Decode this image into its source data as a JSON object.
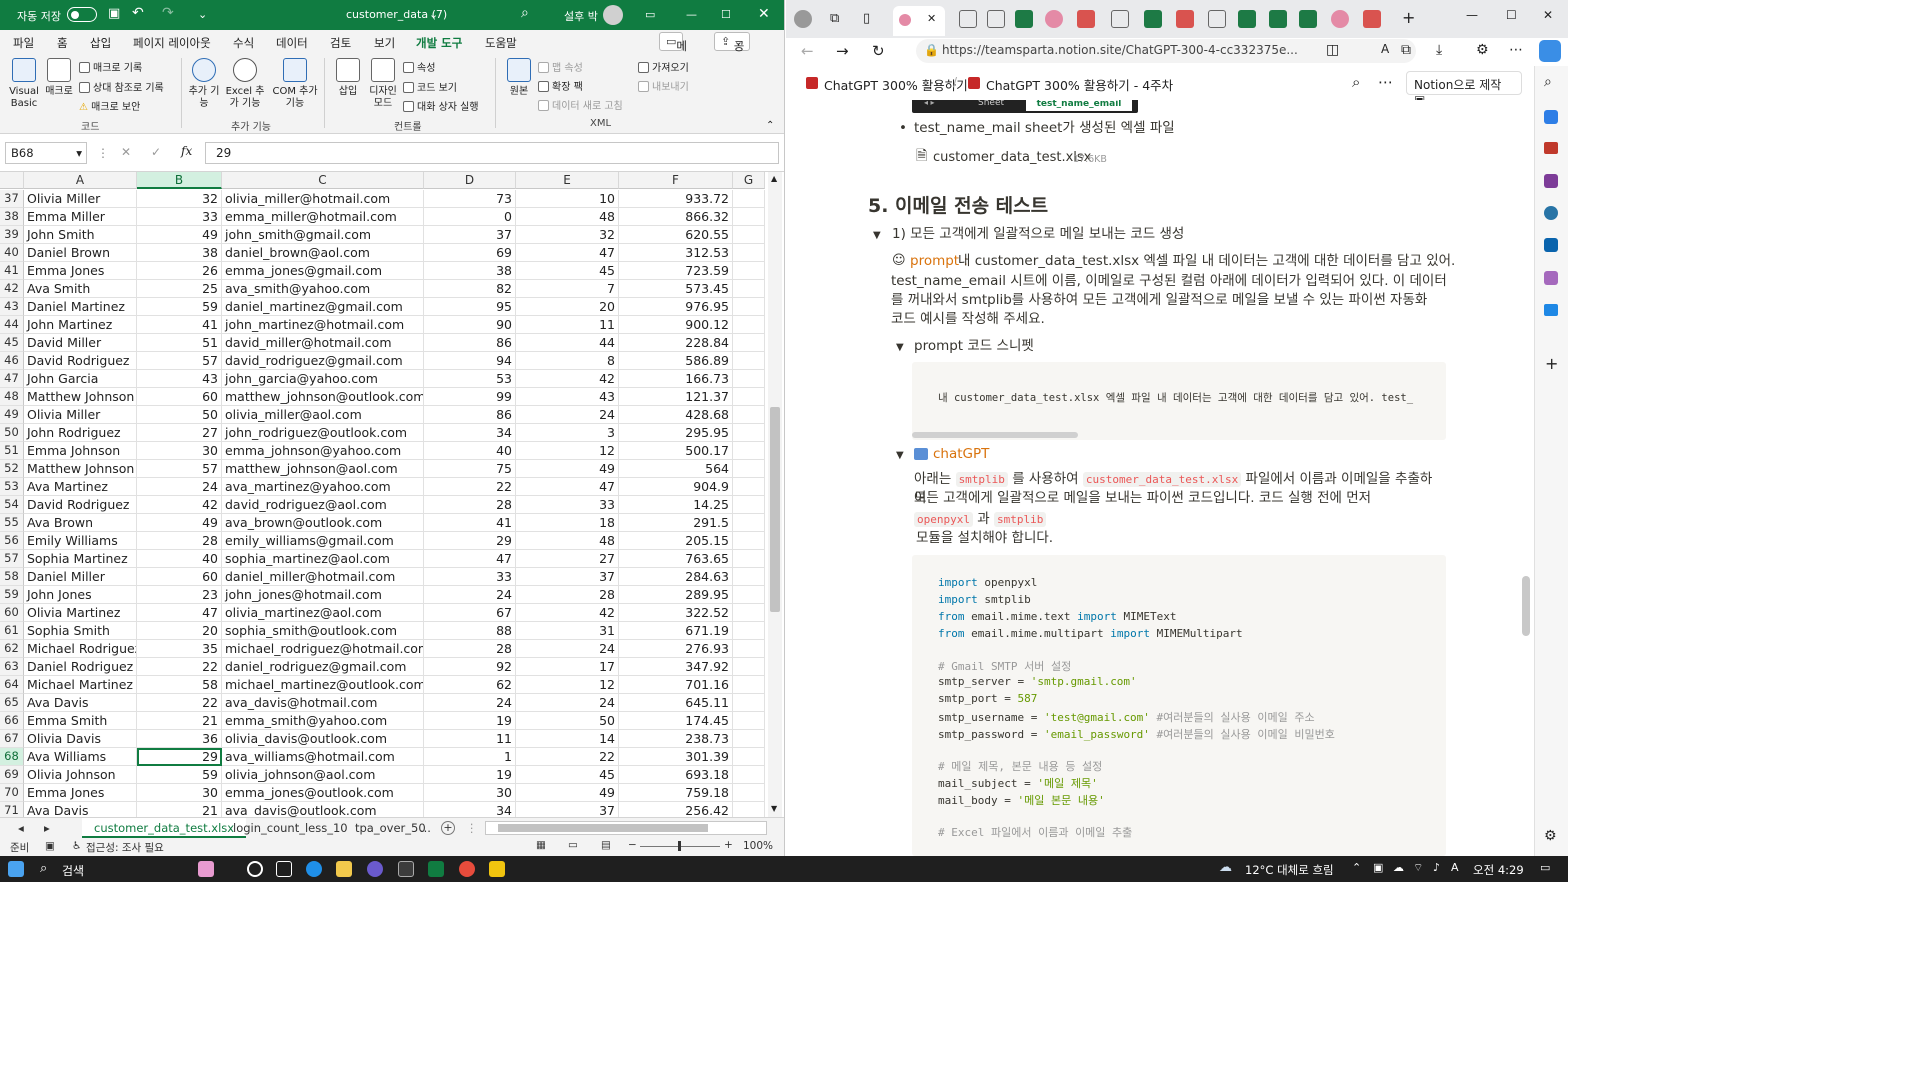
{
  "excel": {
    "autosave_label": "자동 저장",
    "title": "customer_data (7)",
    "user": "설후 박",
    "tabs": [
      "파일",
      "홈",
      "삽입",
      "페이지 레이아웃",
      "수식",
      "데이터",
      "검토",
      "보기",
      "개발 도구",
      "도움말"
    ],
    "active_tab": "개발 도구",
    "memo_label": "메모",
    "share_label": "공유",
    "ribbon": {
      "visual_basic": "Visual Basic",
      "macro": "매크로",
      "record_macro": "매크로 기록",
      "relative_ref": "상대 참조로 기록",
      "macro_security": "매크로 보안",
      "group_code": "코드",
      "addin": "추가 기능",
      "excel_addin": "Excel 추가 기능",
      "com_addin": "COM 추가 기능",
      "group_addins": "추가 기능",
      "insert": "삽입",
      "design_mode": "디자인 모드",
      "properties": "속성",
      "view_code": "코드 보기",
      "run_dialog": "대화 상자 실행",
      "group_controls": "컨트롤",
      "source": "원본",
      "map_props": "맵 속성",
      "expansion_packs": "확장 팩",
      "refresh_data": "데이터 새로 고침",
      "import": "가져오기",
      "export": "내보내기",
      "group_xml": "XML"
    },
    "name_box": "B68",
    "formula": "29",
    "columns": [
      "A",
      "B",
      "C",
      "D",
      "E",
      "F",
      "G"
    ],
    "rows": [
      [
        "37",
        "Olivia Miller",
        "32",
        "olivia_miller@hotmail.com",
        "73",
        "10",
        "933.72"
      ],
      [
        "38",
        "Emma Miller",
        "33",
        "emma_miller@hotmail.com",
        "0",
        "48",
        "866.32"
      ],
      [
        "39",
        "John Smith",
        "49",
        "john_smith@gmail.com",
        "37",
        "32",
        "620.55"
      ],
      [
        "40",
        "Daniel Brown",
        "38",
        "daniel_brown@aol.com",
        "69",
        "47",
        "312.53"
      ],
      [
        "41",
        "Emma Jones",
        "26",
        "emma_jones@gmail.com",
        "38",
        "45",
        "723.59"
      ],
      [
        "42",
        "Ava Smith",
        "25",
        "ava_smith@yahoo.com",
        "82",
        "7",
        "573.45"
      ],
      [
        "43",
        "Daniel Martinez",
        "59",
        "daniel_martinez@gmail.com",
        "95",
        "20",
        "976.95"
      ],
      [
        "44",
        "John Martinez",
        "41",
        "john_martinez@hotmail.com",
        "90",
        "11",
        "900.12"
      ],
      [
        "45",
        "David Miller",
        "51",
        "david_miller@hotmail.com",
        "86",
        "44",
        "228.84"
      ],
      [
        "46",
        "David Rodriguez",
        "57",
        "david_rodriguez@gmail.com",
        "94",
        "8",
        "586.89"
      ],
      [
        "47",
        "John Garcia",
        "43",
        "john_garcia@yahoo.com",
        "53",
        "42",
        "166.73"
      ],
      [
        "48",
        "Matthew Johnson",
        "60",
        "matthew_johnson@outlook.com",
        "99",
        "43",
        "121.37"
      ],
      [
        "49",
        "Olivia Miller",
        "50",
        "olivia_miller@aol.com",
        "86",
        "24",
        "428.68"
      ],
      [
        "50",
        "John Rodriguez",
        "27",
        "john_rodriguez@outlook.com",
        "34",
        "3",
        "295.95"
      ],
      [
        "51",
        "Emma Johnson",
        "30",
        "emma_johnson@yahoo.com",
        "40",
        "12",
        "500.17"
      ],
      [
        "52",
        "Matthew Johnson",
        "57",
        "matthew_johnson@aol.com",
        "75",
        "49",
        "564"
      ],
      [
        "53",
        "Ava Martinez",
        "24",
        "ava_martinez@yahoo.com",
        "22",
        "47",
        "904.9"
      ],
      [
        "54",
        "David Rodriguez",
        "42",
        "david_rodriguez@aol.com",
        "28",
        "33",
        "14.25"
      ],
      [
        "55",
        "Ava Brown",
        "49",
        "ava_brown@outlook.com",
        "41",
        "18",
        "291.5"
      ],
      [
        "56",
        "Emily Williams",
        "28",
        "emily_williams@gmail.com",
        "29",
        "48",
        "205.15"
      ],
      [
        "57",
        "Sophia Martinez",
        "40",
        "sophia_martinez@aol.com",
        "47",
        "27",
        "763.65"
      ],
      [
        "58",
        "Daniel Miller",
        "60",
        "daniel_miller@hotmail.com",
        "33",
        "37",
        "284.63"
      ],
      [
        "59",
        "John Jones",
        "23",
        "john_jones@hotmail.com",
        "24",
        "28",
        "289.95"
      ],
      [
        "60",
        "Olivia Martinez",
        "47",
        "olivia_martinez@aol.com",
        "67",
        "42",
        "322.52"
      ],
      [
        "61",
        "Sophia Smith",
        "20",
        "sophia_smith@outlook.com",
        "88",
        "31",
        "671.19"
      ],
      [
        "62",
        "Michael Rodriguez",
        "35",
        "michael_rodriguez@hotmail.com",
        "28",
        "24",
        "276.93"
      ],
      [
        "63",
        "Daniel Rodriguez",
        "22",
        "daniel_rodriguez@gmail.com",
        "92",
        "17",
        "347.92"
      ],
      [
        "64",
        "Michael Martinez",
        "58",
        "michael_martinez@outlook.com",
        "62",
        "12",
        "701.16"
      ],
      [
        "65",
        "Ava Davis",
        "22",
        "ava_davis@hotmail.com",
        "24",
        "24",
        "645.11"
      ],
      [
        "66",
        "Emma Smith",
        "21",
        "emma_smith@yahoo.com",
        "19",
        "50",
        "174.45"
      ],
      [
        "67",
        "Olivia Davis",
        "36",
        "olivia_davis@outlook.com",
        "11",
        "14",
        "238.73"
      ],
      [
        "68",
        "Ava Williams",
        "29",
        "ava_williams@hotmail.com",
        "1",
        "22",
        "301.39"
      ],
      [
        "69",
        "Olivia Johnson",
        "59",
        "olivia_johnson@aol.com",
        "19",
        "45",
        "693.18"
      ],
      [
        "70",
        "Emma Jones",
        "30",
        "emma_jones@outlook.com",
        "30",
        "49",
        "759.18"
      ],
      [
        "71",
        "Ava Davis",
        "21",
        "ava_davis@outlook.com",
        "34",
        "37",
        "256.42"
      ]
    ],
    "selected_row": "68",
    "sheet_tabs": [
      "customer_data_test.xlsx",
      "login_count_less_10",
      "tpa_over_50"
    ],
    "sheet_tabs_more": "...",
    "status_ready": "준비",
    "status_accessibility": "접근성: 조사 필요",
    "zoom": "100%"
  },
  "browser": {
    "url": "https://teamsparta.notion.site/ChatGPT-300-4-cc332375e...",
    "breadcrumb_1": "ChatGPT 300% 활용하기",
    "breadcrumb_sep": "/",
    "breadcrumb_2": "ChatGPT 300% 활용하기 - 4주차",
    "made_with": "Notion으로 제작",
    "img_tab_sheet": "Sheet",
    "img_tab_active": "test_name_email",
    "bullet_text": "test_name_mail sheet가 생성된 엑셀 파일",
    "file_name": "customer_data_test.xlsx",
    "file_size": "17.6KB",
    "heading": "5. 이메일 전송 테스트",
    "toggle_1": "1) 모든 고객에게 일괄적으로 메일 보내는 코드 생성",
    "prompt_label": "prompt :",
    "prompt_text_1": " 내 customer_data_test.xlsx 엑셀 파일 내 데이터는 고객에 대한 데이터를 담고 있어.",
    "prompt_text_2": "test_name_email 시트에 이름, 이메일로 구성된 컬럼 아래에 데이터가 입력되어 있다. 이 데이터",
    "prompt_text_3": "를 꺼내와서 smtplib를 사용하여 모든 고객에게 일괄적으로 메일을 보낼 수 있는 파이썬 자동화",
    "prompt_text_4": "코드 예시를 작성해 주세요.",
    "toggle_snippet": "prompt 코드 스니펫",
    "snippet_text": "내 customer_data_test.xlsx 엑셀 파일 내 데이터는 고객에 대한 데이터를 담고 있어. test_",
    "toggle_chatgpt": "chatGPT",
    "answer_1a": "아래는 ",
    "answer_code_1": "smtplib",
    "answer_1b": " 를 사용하여 ",
    "answer_code_2": "customer_data_test.xlsx",
    "answer_1c": " 파일에서 이름과 이메일을 추출하여",
    "answer_2": "모든 고객에게 일괄적으로 메일을 보내는 파이썬 코드입니다. 코드 실행 전에 먼저",
    "answer_code_3": "openpyxl",
    "answer_3b": " 과 ",
    "answer_code_4": "smtplib",
    "answer_4": "모듈을 설치해야 합니다.",
    "code_lines": [
      {
        "k": "import",
        "r": " openpyxl"
      },
      {
        "k": "import",
        "r": " smtplib"
      },
      {
        "k": "from",
        "r": " email.mime.text ",
        "k2": "import",
        "r2": " MIMEText"
      },
      {
        "k": "from",
        "r": " email.mime.multipart ",
        "k2": "import",
        "r2": " MIMEMultipart"
      },
      {
        "c": "# Gmail SMTP 서버 설정"
      },
      {
        "r": "smtp_server = ",
        "s": "'smtp.gmail.com'"
      },
      {
        "r": "smtp_port = ",
        "s": "587"
      },
      {
        "r": "smtp_username = ",
        "s": "'test@gmail.com'",
        "c": " #여러분들의 실사용 이메일 주소"
      },
      {
        "r": "smtp_password = ",
        "s": "'email_password'",
        "c": " #여러분들의 실사용 이메일 비밀번호"
      },
      {
        "c": "# 메일 제목, 본문 내용 등 설정"
      },
      {
        "r": "mail_subject = ",
        "s": "'메일 제목'"
      },
      {
        "r": "mail_body = ",
        "s": "'메일 본문 내용'"
      },
      {
        "c": "# Excel 파일에서 이름과 이메일 추출"
      }
    ]
  },
  "taskbar": {
    "search": "검색",
    "weather": "12°C 대체로 흐림",
    "time": "오전 4:29"
  }
}
